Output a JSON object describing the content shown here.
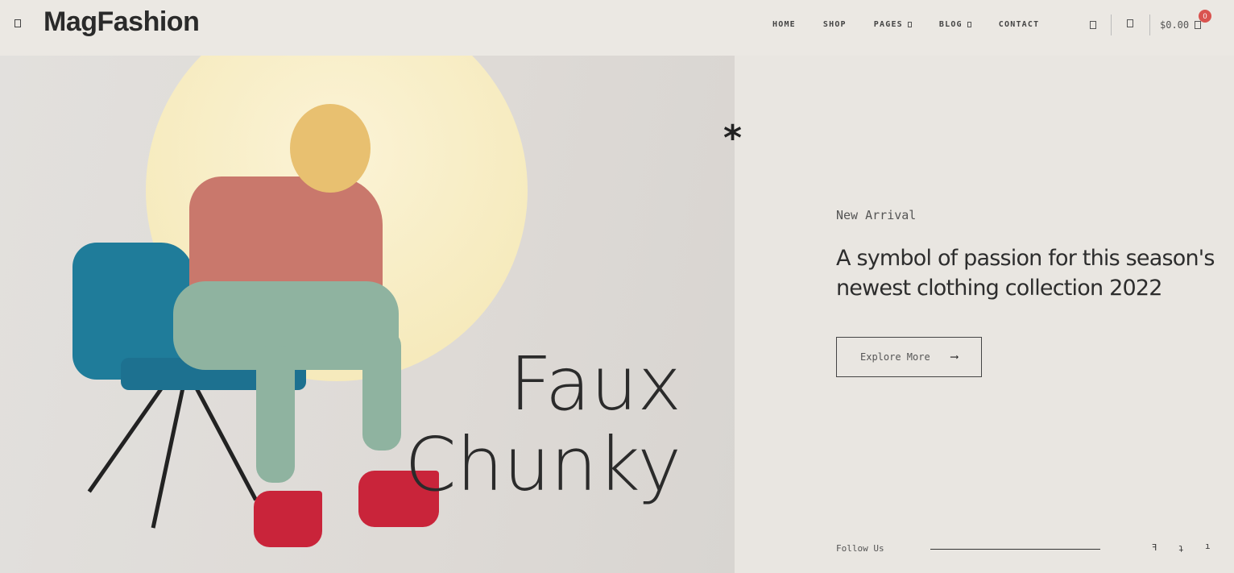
{
  "header": {
    "logo": "MagFashion",
    "menu_icon": "hamburger-icon",
    "nav": [
      {
        "label": "HOME"
      },
      {
        "label": "SHOP"
      },
      {
        "label": "PAGES",
        "dropdown": true
      },
      {
        "label": "BLOG",
        "dropdown": true
      },
      {
        "label": "CONTACT"
      }
    ],
    "icons": [
      "search-icon",
      "user-icon",
      "cart-icon"
    ],
    "cart_total": "$0.00",
    "cart_count": "0",
    "badge_color": "#d9534f"
  },
  "hero": {
    "overlay_line1": "Faux",
    "overlay_line2": "Chunky",
    "asterisk": "*",
    "tag": "New Arrival",
    "headline": "A symbol of passion for this season's newest clothing collection 2022",
    "cta_label": "Explore More",
    "cta_arrow": "⟶"
  },
  "footer": {
    "follow_label": "Follow Us",
    "social_icons": [
      "facebook-icon",
      "twitter-icon",
      "instagram-icon"
    ]
  }
}
